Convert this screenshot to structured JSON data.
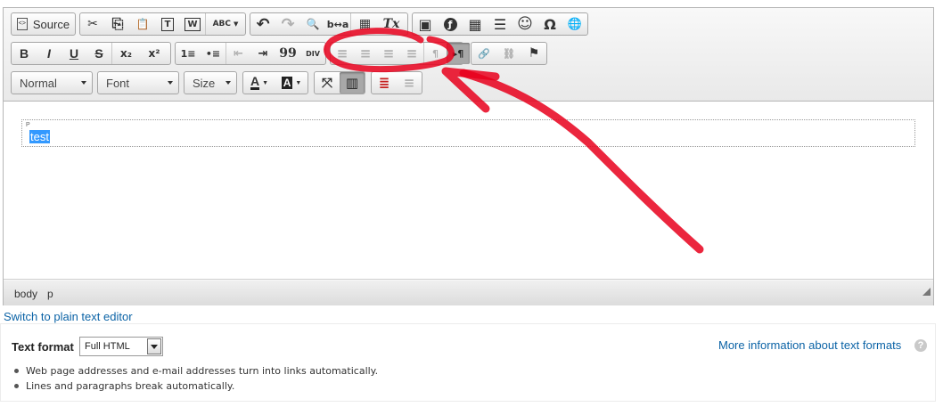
{
  "toolbar": {
    "source_label": "Source",
    "format_label": "Normal",
    "font_label": "Font",
    "size_label": "Size",
    "glyphs": {
      "cut": "✂",
      "copy": "⎘",
      "paste": "📋",
      "paste_text": "T",
      "paste_word": "W",
      "spellcheck": "ABC",
      "undo": "↶",
      "redo": "↷",
      "find": "🔍",
      "replace": "b↔a",
      "select_all": "▦",
      "remove_format": "Tx",
      "image": "▣",
      "flash": "ƒ",
      "table": "▦",
      "hr": "☰",
      "smiley": "☺",
      "special_char": "Ω",
      "iframe": "🌐",
      "bold": "B",
      "italic": "I",
      "underline": "U",
      "strike": "S",
      "subscript": "x₂",
      "superscript": "x²",
      "numbered_list": "1≡",
      "bulleted_list": "•≡",
      "outdent": "⇤",
      "indent": "⇥",
      "blockquote": "99",
      "div": "DIV",
      "align_left": "≡",
      "align_center": "≡",
      "align_right": "≡",
      "justify": "≡",
      "ltr": "¶",
      "rtl": "▸¶",
      "link": "🔗",
      "unlink": "⛓",
      "anchor": "⚑",
      "text_color": "A",
      "bg_color": "A",
      "maximize": "⤧",
      "show_blocks": "▥",
      "show_borders": "≣",
      "center": "≡"
    }
  },
  "content": {
    "block_label": "P",
    "text": "test"
  },
  "path_bar": {
    "items": [
      "body",
      "p"
    ]
  },
  "switch_link": "Switch to plain text editor",
  "text_format": {
    "label": "Text format",
    "selected": "Full HTML",
    "more_info": "More information about text formats",
    "help_glyph": "?",
    "tips": [
      "Web page addresses and e-mail addresses turn into links automatically.",
      "Lines and paragraphs break automatically."
    ]
  },
  "colors": {
    "link": "#0b63a6",
    "selection": "#3399ff",
    "annotation": "#e8001c"
  }
}
